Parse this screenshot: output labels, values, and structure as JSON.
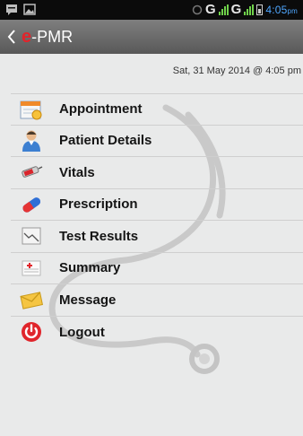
{
  "status_bar": {
    "network_1": "G",
    "network_2": "G",
    "time": "4:05",
    "time_suffix": "pm"
  },
  "app_bar": {
    "logo_letter": "e",
    "title_rest": "-PMR"
  },
  "header": {
    "datetime": "Sat, 31 May 2014 @ 4:05 pm"
  },
  "menu": {
    "items": [
      {
        "label": "Appointment",
        "icon": "calendar-icon"
      },
      {
        "label": "Patient Details",
        "icon": "patient-icon"
      },
      {
        "label": "Vitals",
        "icon": "injection-icon"
      },
      {
        "label": "Prescription",
        "icon": "pill-icon"
      },
      {
        "label": "Test Results",
        "icon": "chart-icon"
      },
      {
        "label": "Summary",
        "icon": "summary-icon"
      },
      {
        "label": "Message",
        "icon": "envelope-icon"
      },
      {
        "label": "Logout",
        "icon": "power-icon"
      }
    ]
  },
  "colors": {
    "accent": "#e2242b",
    "app_bar": "#6e6e6e",
    "status_time": "#4fa7ff",
    "background": "#e9eaea"
  }
}
